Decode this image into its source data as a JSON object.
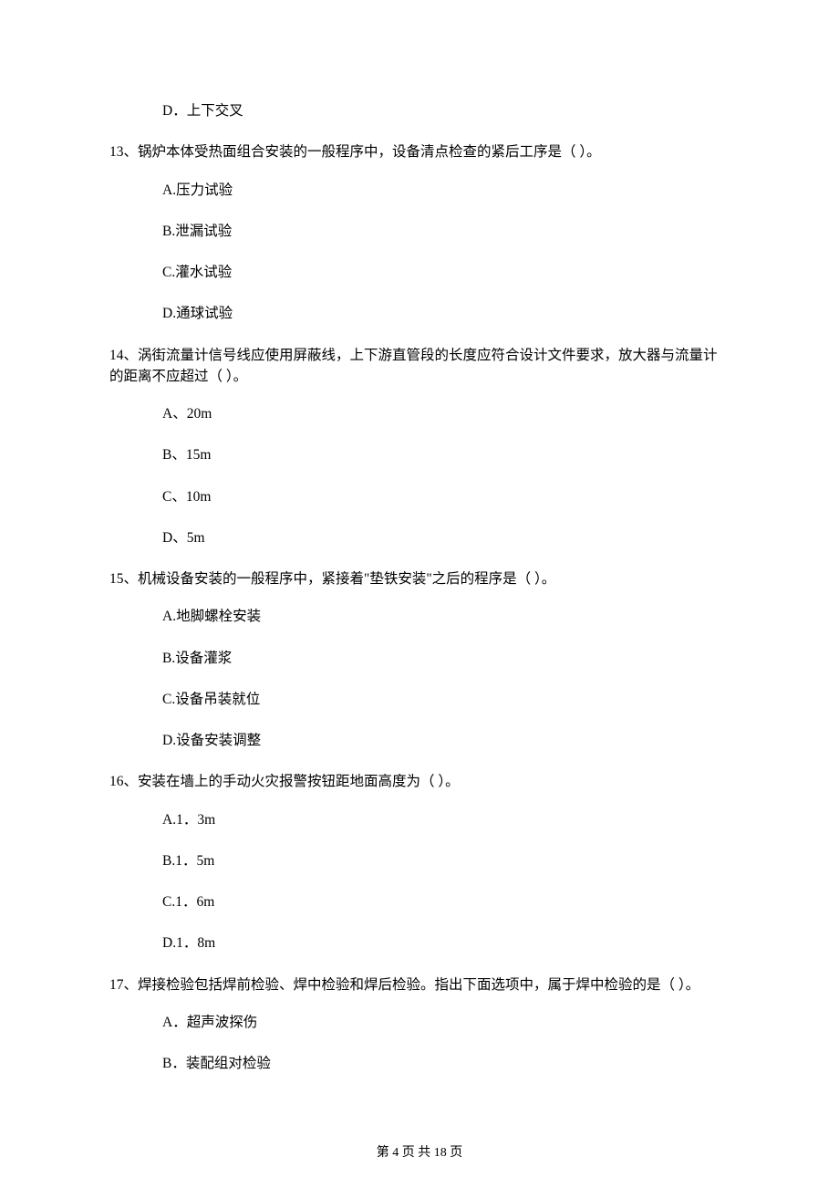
{
  "prevTrailingOption": "D．上下交叉",
  "questions": [
    {
      "stem": "13、锅炉本体受热面组合安装的一般程序中，设备清点检查的紧后工序是（    ）。",
      "options": [
        "A.压力试验",
        "B.泄漏试验",
        "C.灌水试验",
        "D.通球试验"
      ]
    },
    {
      "stem": "14、涡街流量计信号线应使用屏蔽线，上下游直管段的长度应符合设计文件要求，放大器与流量计的距离不应超过（    ）。",
      "options": [
        "A、20m",
        "B、15m",
        "C、10m",
        "D、5m"
      ]
    },
    {
      "stem": "15、机械设备安装的一般程序中，紧接着\"垫铁安装\"之后的程序是（    ）。",
      "options": [
        "A.地脚螺栓安装",
        "B.设备灌浆",
        "C.设备吊装就位",
        "D.设备安装调整"
      ]
    },
    {
      "stem": "16、安装在墙上的手动火灾报警按钮距地面高度为（    ）。",
      "options": [
        "A.1．3m",
        "B.1．5m",
        "C.1．6m",
        "D.1．8m"
      ]
    },
    {
      "stem": "17、焊接检验包括焊前检验、焊中检验和焊后检验。指出下面选项中，属于焊中检验的是（    ）。",
      "options": [
        "A．超声波探伤",
        "B．装配组对检验"
      ]
    }
  ],
  "footer": "第 4 页 共 18 页"
}
